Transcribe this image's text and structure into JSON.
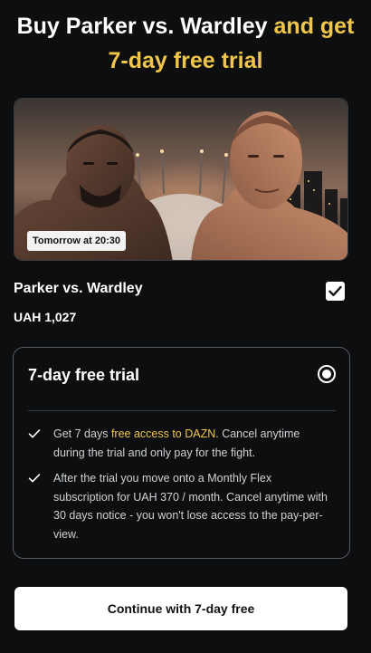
{
  "header": {
    "line1_white": "Buy Parker vs. Wardley",
    "line1_gold": "and get",
    "line2_gold": "7-day free trial"
  },
  "hero": {
    "badge": "Tomorrow at 20:30"
  },
  "event": {
    "title": "Parker vs. Wardley",
    "price": "UAH 1,027",
    "selected": true
  },
  "trial": {
    "title": "7-day free trial",
    "selected": true,
    "bullets": [
      {
        "pre": "Get 7 days ",
        "highlight": "free access to DAZN.",
        "post": " Cancel anytime during the trial and only pay for the fight."
      },
      {
        "text": "After the trial you move onto a Monthly Flex subscription for UAH 370 / month. Cancel anytime with 30 days notice - you won't lose access to the pay-per-view."
      }
    ]
  },
  "cta": {
    "label_prefix": "Continue with",
    "label_bold": "7-day free"
  },
  "colors": {
    "background": "#0c0e10",
    "accent_gold": "#f0c64a",
    "card_border": "#5a5d61",
    "cta_background": "#ffffff"
  },
  "icons": [
    "checkbox-checked-icon",
    "radio-selected-icon",
    "check-icon"
  ]
}
